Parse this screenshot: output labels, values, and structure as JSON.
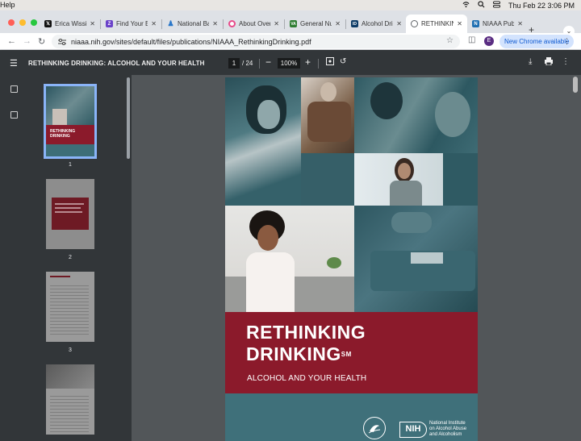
{
  "menubar": {
    "help": "Help",
    "datetime": "Thu Feb 22  3:06 PM"
  },
  "tabs": [
    {
      "title": "Erica Wissi",
      "favicon": "X",
      "color": "#111111"
    },
    {
      "title": "Find Your B",
      "favicon": "Z",
      "color": "#6a42c9"
    },
    {
      "title": "National Ba",
      "favicon": "person",
      "color": "#2a77c9"
    },
    {
      "title": "About Over",
      "favicon": "globe",
      "color": "#e84a8a"
    },
    {
      "title": "General Nu",
      "favicon": "VA",
      "color": "#2e7d32"
    },
    {
      "title": "Alcohol Drin",
      "favicon": "ID",
      "color": "#0d3b66"
    },
    {
      "title": "RETHINKIN",
      "favicon": "globe",
      "color": "#5f6368"
    },
    {
      "title": "NIAAA Publ",
      "favicon": "N",
      "color": "#1f6fb2"
    }
  ],
  "toolbar": {
    "url": "niaaa.nih.gov/sites/default/files/publications/NIAAA_RethinkingDrinking.pdf",
    "avatar": "E",
    "new_chrome": "New Chrome available"
  },
  "pdf": {
    "title": "RETHINKING DRINKING: ALCOHOL AND YOUR HEALTH",
    "page": "1",
    "page_total": "/ 24",
    "zoom": "100%"
  },
  "thumbnails": [
    {
      "num": "1"
    },
    {
      "num": "2"
    },
    {
      "num": "3"
    }
  ],
  "cover": {
    "title_line1": "RETHINKING",
    "title_line2": "DRINKING",
    "title_mark": "SM",
    "subtitle": "ALCOHOL AND YOUR HEALTH",
    "nih": "NIH",
    "institute_line1": "National Institute",
    "institute_line2": "on Alcohol Abuse",
    "institute_line3": "and Alcoholism"
  },
  "colors": {
    "accent": "#8b1a2b",
    "teal": "#3d6e78",
    "selected_outline": "#8ab4f8"
  }
}
